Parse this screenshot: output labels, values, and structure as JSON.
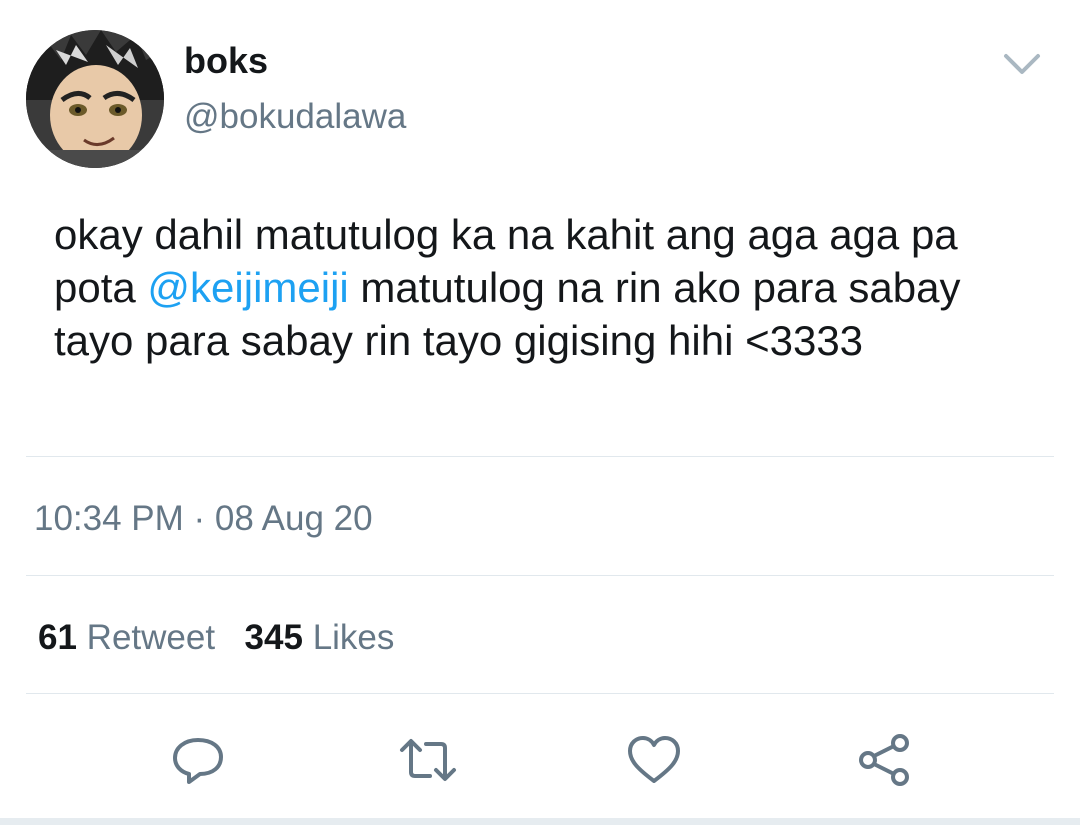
{
  "author": {
    "display_name": "boks",
    "handle": "@bokudalawa",
    "avatar_icon": "anime-avatar"
  },
  "tweet": {
    "text_part1": "okay dahil matutulog ka na kahit ang aga aga pa pota ",
    "mention": "@keijimeiji",
    "text_part2": " matutulog na rin ako para sabay tayo para sabay rin tayo gigising hihi <3333"
  },
  "meta": {
    "timestamp": "10:34 PM · 08 Aug 20"
  },
  "stats": {
    "retweet_count": "61",
    "retweet_label": "Retweet",
    "like_count": "345",
    "like_label": "Likes"
  },
  "actions": {
    "reply_icon": "reply-icon",
    "retweet_icon": "retweet-icon",
    "like_icon": "heart-icon",
    "share_icon": "share-icon"
  },
  "colors": {
    "text": "#14171a",
    "secondary": "#657786",
    "link": "#1da1f2",
    "divider": "#e1e8ed"
  }
}
